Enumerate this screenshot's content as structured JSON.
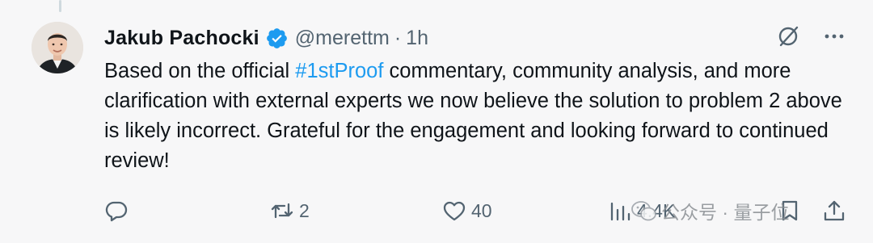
{
  "tweet": {
    "author_name": "Jakub Pachocki",
    "handle": "@merettm",
    "separator": "·",
    "time": "1h",
    "text_before": "Based on the official ",
    "hashtag": "#1stProof",
    "text_after": " commentary, community analysis, and more clarification with external experts we now believe the solution to problem 2 above is likely incorrect. Grateful for the engagement and looking forward to continued review!",
    "colors": {
      "link": "#1d9bf0",
      "secondary_text": "#536471",
      "verified": "#1d9bf0"
    }
  },
  "actions": {
    "reply_count": "",
    "retweet_count": "2",
    "like_count": "40",
    "views_count": "4.4K"
  },
  "watermark": {
    "text": "公众号 · 量子位"
  },
  "icons": {
    "verified": "verified-badge-icon",
    "grok": "grok-icon",
    "more": "more-icon",
    "reply": "reply-icon",
    "retweet": "retweet-icon",
    "like": "like-icon",
    "views": "views-icon",
    "bookmark": "bookmark-icon",
    "share": "share-icon"
  }
}
